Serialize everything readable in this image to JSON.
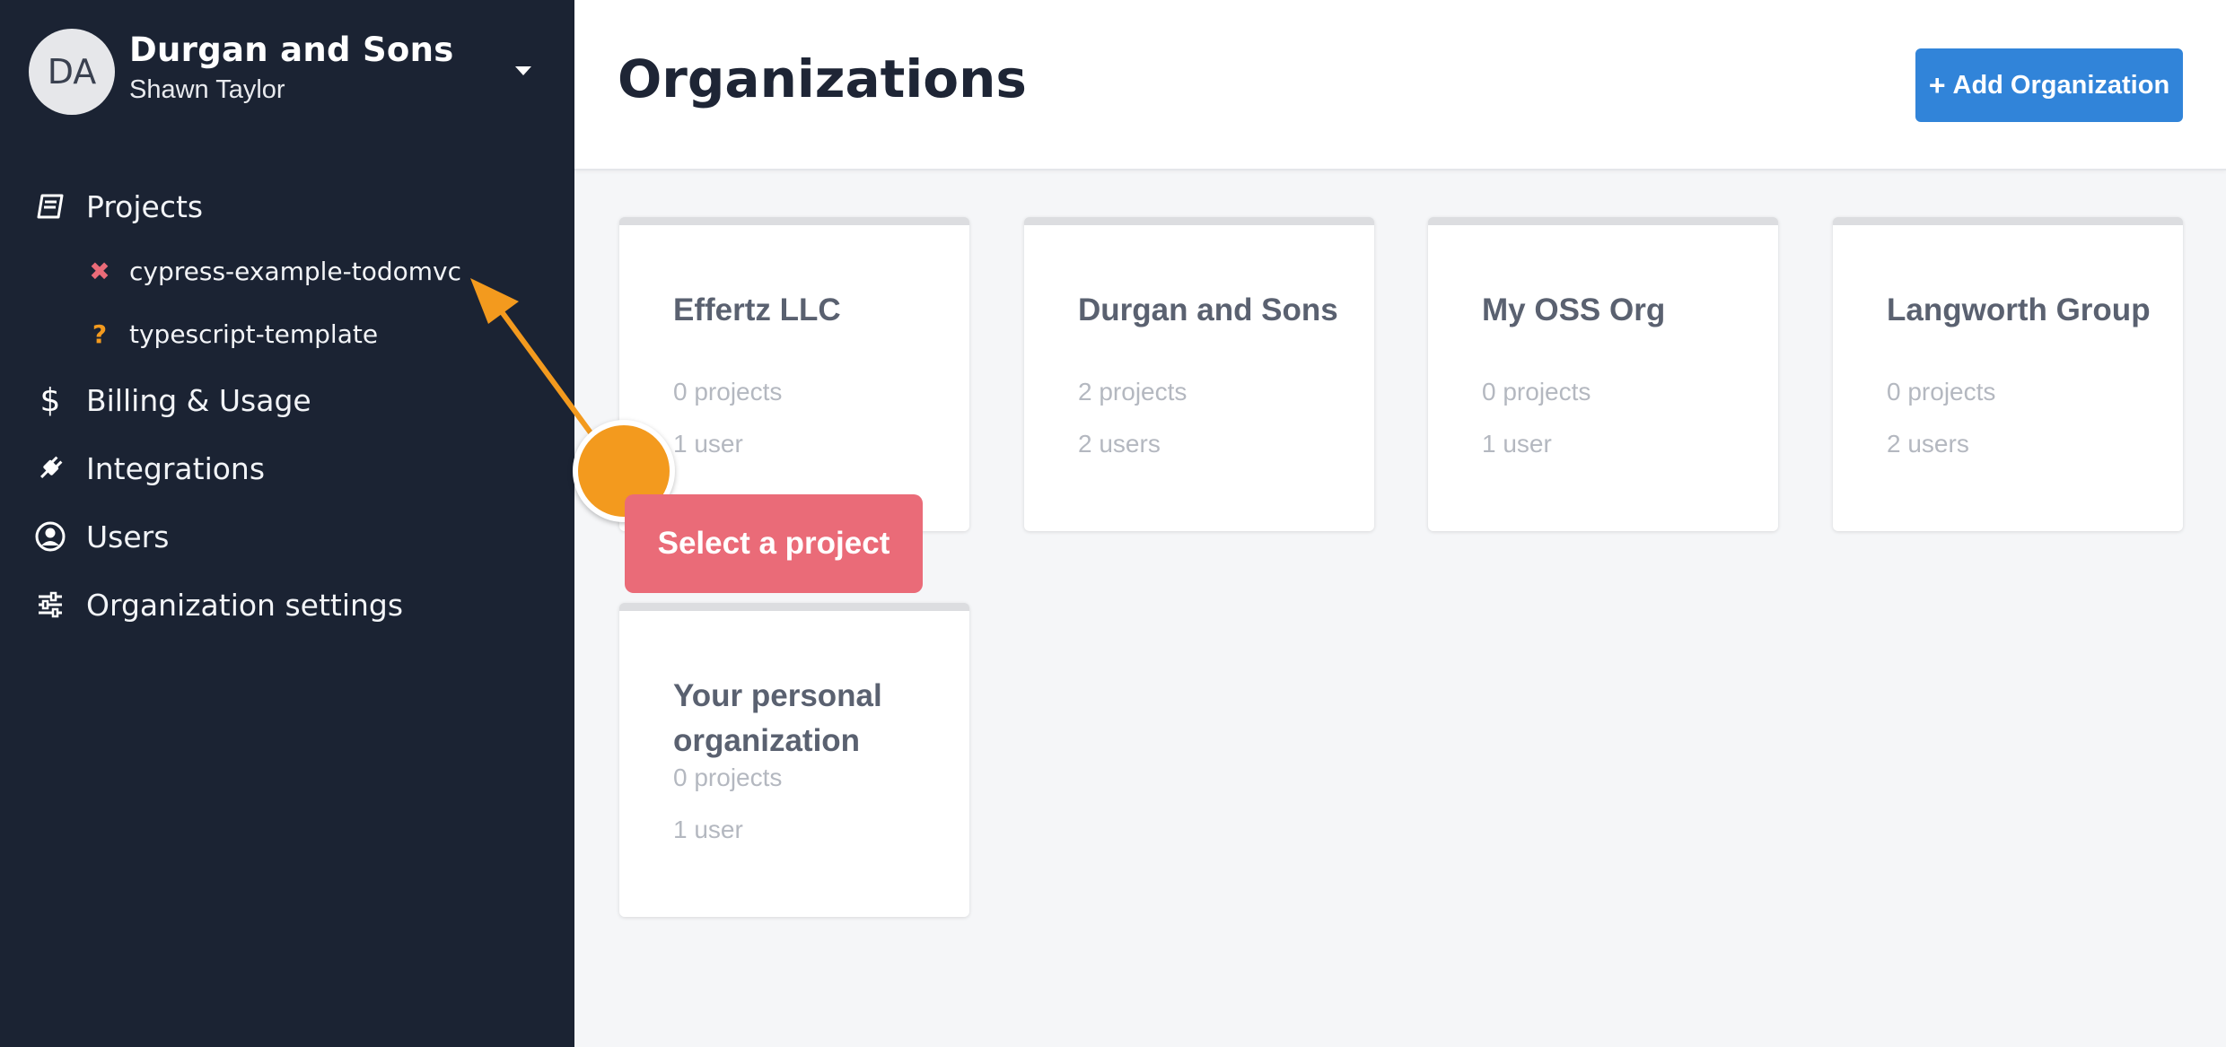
{
  "sidebar": {
    "org": {
      "avatar_initials": "DA",
      "name": "Durgan and Sons",
      "user": "Shawn Taylor"
    },
    "nav": {
      "projects": "Projects",
      "billing": "Billing & Usage",
      "integrations": "Integrations",
      "users": "Users",
      "org_settings": "Organization settings"
    },
    "projects": [
      {
        "label": "cypress-example-todomvc",
        "status_glyph": "✖",
        "status_color": "#ea6b78"
      },
      {
        "label": "typescript-template",
        "status_glyph": "?",
        "status_color": "#f39a1e"
      }
    ]
  },
  "header": {
    "title": "Organizations",
    "add_button_icon": "plus-icon",
    "add_button_label": "Add Organization"
  },
  "organizations": [
    {
      "name": "Effertz LLC",
      "projects": "0 projects",
      "users": "1 user"
    },
    {
      "name": "Durgan and Sons",
      "projects": "2 projects",
      "users": "2 users"
    },
    {
      "name": "My OSS Org",
      "projects": "0 projects",
      "users": "1 user"
    },
    {
      "name": "Langworth Group",
      "projects": "0 projects",
      "users": "2 users"
    },
    {
      "name": "Your personal organization",
      "projects": "0 projects",
      "users": "1 user"
    }
  ],
  "annotation": {
    "tooltip": "Select a project"
  },
  "colors": {
    "sidebar_bg": "#1b2333",
    "accent_blue": "#3184d9",
    "annotation_orange": "#f39a1e",
    "annotation_pink": "#ea6b78"
  }
}
